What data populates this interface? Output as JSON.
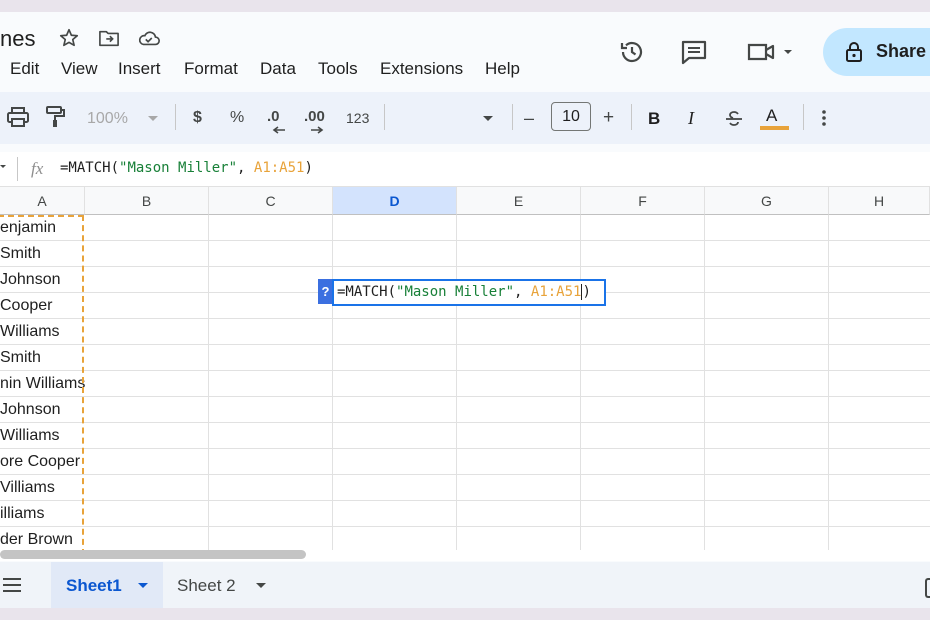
{
  "doc": {
    "title_partial": "nes"
  },
  "menu": [
    "Edit",
    "View",
    "Insert",
    "Format",
    "Data",
    "Tools",
    "Extensions",
    "Help"
  ],
  "share_label": "Share",
  "toolbar": {
    "zoom": "100%",
    "currency": "$",
    "percent": "%",
    "dec_decrease": ".0",
    "dec_increase": ".00",
    "number_format": "123",
    "minus": "–",
    "font_size": "10",
    "plus": "+",
    "bold": "B",
    "italic": "I",
    "text_color": "A"
  },
  "formula_bar": {
    "fx": "fx",
    "fn": "=MATCH(",
    "str": "\"Mason Miller\"",
    "comma": ", ",
    "ref": "A1:A51",
    "close": ")"
  },
  "columns": [
    "A",
    "B",
    "C",
    "D",
    "E",
    "F",
    "G",
    "H"
  ],
  "colA_values": [
    "enjamin",
    "Smith",
    "Johnson",
    "Cooper",
    "Williams",
    " Smith",
    "nin Williams",
    "Johnson",
    "Williams",
    "ore Cooper",
    "Villiams",
    "illiams",
    "der Brown"
  ],
  "cell_editor": {
    "help": "?",
    "fn": "=MATCH(",
    "str": "\"Mason Miller\"",
    "comma": ", ",
    "ref": "A1:A51",
    "close": ")"
  },
  "sheets": [
    {
      "label": "Sheet1",
      "active": true
    },
    {
      "label": "Sheet 2",
      "active": false
    }
  ],
  "colors": {
    "accent": "#0b57d0",
    "share_bg": "#c2e7ff",
    "selected_col": "#d3e3fd",
    "string": "#188038",
    "range": "#e8a33a"
  }
}
